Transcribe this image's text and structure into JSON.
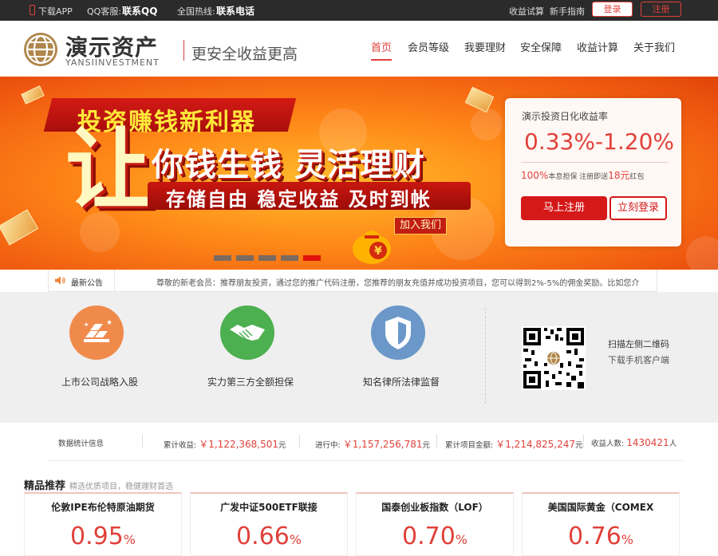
{
  "topbar": {
    "download_app": "下载APP",
    "qq_label": "QQ客服:",
    "qq_value": "联系QQ",
    "hotline_label": "全国热线:",
    "hotline_value": "联系电话",
    "trial": "收益试算",
    "guide": "新手指南",
    "login": "登录",
    "register": "注册"
  },
  "header": {
    "logo_cn": "演示资产",
    "logo_en": "YANSIINVESTMENT",
    "slogan": "更安全收益更高",
    "nav": [
      "首页",
      "会员等级",
      "我要理财",
      "安全保障",
      "收益计算",
      "关于我们"
    ]
  },
  "banner": {
    "tag": "投资赚钱新利器",
    "big_char": "让",
    "line2": "你钱生钱  灵活理财",
    "line3": "存储自由  稳定收益  及时到帐",
    "join": "加入我们",
    "bag_char": "¥",
    "slides": 5,
    "active_slide": 5
  },
  "rate_card": {
    "title": "演示投资日化收益率",
    "rate": "0.33%-1.20%",
    "sub_pct": "100%",
    "sub_mid": "本息担保 注册即送",
    "sub_amt": "18元",
    "sub_tail": "红包",
    "register": "马上注册",
    "login": "立刻登录"
  },
  "notice": {
    "label": "最新公告",
    "text": "尊敬的新老会员：推荐朋友投资，通过您的推广代码注册，您推荐的朋友充值并成功投资项目，您可以得到2%-5%的佣金奖励。比如您介"
  },
  "features": [
    {
      "label": "上市公司战略入股",
      "icon": "gold-bars-icon",
      "color": "#f08a4b"
    },
    {
      "label": "实力第三方全额担保",
      "icon": "handshake-icon",
      "color": "#4caf50"
    },
    {
      "label": "知名律所法律监督",
      "icon": "shield-icon",
      "color": "#6b98c9"
    }
  ],
  "qr": {
    "line1": "扫描左侧二维码",
    "line2": "下载手机客户端"
  },
  "stats": {
    "label": "数据统计信息",
    "total_income_label": "累计收益:",
    "total_income": "￥1,122,368,501",
    "total_income_unit": "元",
    "in_progress_label": "进行中:",
    "in_progress": "￥1,157,256,781",
    "in_progress_unit": "元",
    "total_projects_label": "累计项目金额:",
    "total_projects": "￥1,214,825,247",
    "total_projects_unit": "元",
    "users_label": "收益人数:",
    "users": "1430421",
    "users_unit": "人"
  },
  "picks": {
    "title": "精品推荐",
    "subtitle": "精选优质项目，稳健理财首选",
    "items": [
      {
        "name": "伦敦IPE布伦特原油期货",
        "rate": "0.95",
        "unit": "%"
      },
      {
        "name": "广发中证500ETF联接",
        "rate": "0.66",
        "unit": "%"
      },
      {
        "name": "国泰创业板指数（LOF）",
        "rate": "0.70",
        "unit": "%"
      },
      {
        "name": "美国国际黄金（COMEX",
        "rate": "0.76",
        "unit": "%"
      }
    ]
  },
  "colors": {
    "accent": "#e0413a",
    "topbar": "#2b2b2b",
    "banner": "#ff8a18"
  }
}
